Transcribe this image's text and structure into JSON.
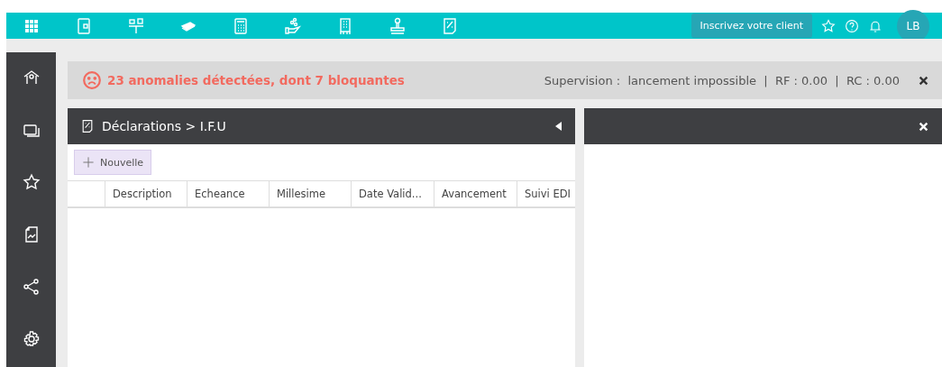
{
  "topbar": {
    "register_button": "Inscrivez votre client",
    "avatar": "LB"
  },
  "alert": {
    "message": "23 anomalies détectées, dont 7 bloquantes",
    "status": "Supervision :  lancement impossible  |  RF : 0.00  |  RC : 0.00"
  },
  "panel": {
    "breadcrumb": "Déclarations > I.F.U",
    "new_button": "Nouvelle"
  },
  "table": {
    "columns": [
      "Description",
      "Echeance",
      "Millesime",
      "Date Valid...",
      "Avancement",
      "Suivi EDI"
    ]
  }
}
